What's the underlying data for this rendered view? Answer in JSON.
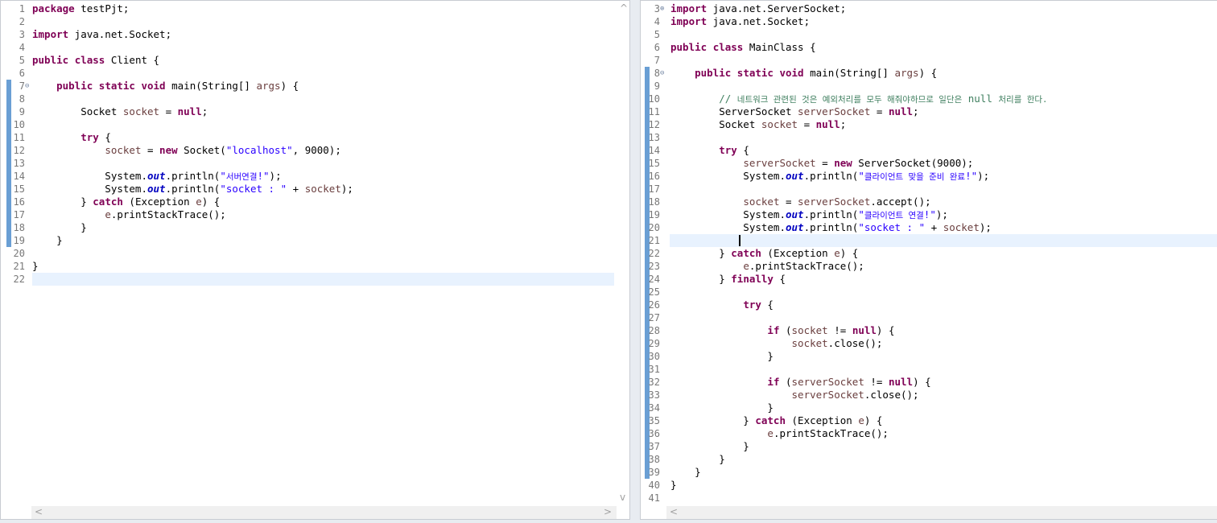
{
  "left_editor": {
    "lines": [
      {
        "n": "1",
        "html": "<span class=\"kw\">package</span> testPjt;"
      },
      {
        "n": "2",
        "html": ""
      },
      {
        "n": "3",
        "html": "<span class=\"kw\">import</span> java.net.Socket;"
      },
      {
        "n": "4",
        "html": ""
      },
      {
        "n": "5",
        "html": "<span class=\"kw\">public</span> <span class=\"kw\">class</span> Client {"
      },
      {
        "n": "6",
        "html": ""
      },
      {
        "n": "7",
        "fold": "⊖",
        "html": "    <span class=\"kw\">public</span> <span class=\"kw\">static</span> <span class=\"kw\">void</span> main(String[] <span class=\"var\">args</span>) {"
      },
      {
        "n": "8",
        "html": ""
      },
      {
        "n": "9",
        "html": "        Socket <span class=\"var\">socket</span> = <span class=\"kw\">null</span>;"
      },
      {
        "n": "10",
        "html": ""
      },
      {
        "n": "11",
        "html": "        <span class=\"kw\">try</span> {"
      },
      {
        "n": "12",
        "html": "            <span class=\"var\">socket</span> = <span class=\"kw\">new</span> Socket(<span class=\"str\">\"localhost\"</span>, 9000);"
      },
      {
        "n": "13",
        "html": ""
      },
      {
        "n": "14",
        "html": "            System.<span class=\"fld\">out</span>.println(<span class=\"str\">\"<span class=\"kr\">서버연결</span>!\"</span>);"
      },
      {
        "n": "15",
        "html": "            System.<span class=\"fld\">out</span>.println(<span class=\"str\">\"socket : \"</span> + <span class=\"var\">socket</span>);"
      },
      {
        "n": "16",
        "html": "        } <span class=\"kw\">catch</span> (Exception <span class=\"var\">e</span>) {"
      },
      {
        "n": "17",
        "html": "            <span class=\"var\">e</span>.printStackTrace();"
      },
      {
        "n": "18",
        "html": "        }"
      },
      {
        "n": "19",
        "html": "    }"
      },
      {
        "n": "20",
        "html": ""
      },
      {
        "n": "21",
        "html": "}"
      },
      {
        "n": "22",
        "html": "",
        "current": true
      }
    ]
  },
  "right_editor": {
    "lines": [
      {
        "n": "3",
        "fold": "⊕",
        "html": "<span class=\"kw\">import</span> java.net.ServerSocket;"
      },
      {
        "n": "4",
        "html": "<span class=\"kw\">import</span> java.net.Socket;"
      },
      {
        "n": "5",
        "html": ""
      },
      {
        "n": "6",
        "html": "<span class=\"kw\">public</span> <span class=\"kw\">class</span> MainClass {"
      },
      {
        "n": "7",
        "html": ""
      },
      {
        "n": "8",
        "fold": "⊖",
        "html": "    <span class=\"kw\">public</span> <span class=\"kw\">static</span> <span class=\"kw\">void</span> main(String[] <span class=\"var\">args</span>) {"
      },
      {
        "n": "9",
        "html": ""
      },
      {
        "n": "10",
        "html": "        <span class=\"cm\">// <span class=\"kr\">네트워크 관련된 것은 예외처리를 모두 해줘야하므로 일단은</span> null <span class=\"kr\">처리를 한다.</span></span>"
      },
      {
        "n": "11",
        "html": "        ServerSocket <span class=\"var\">serverSocket</span> = <span class=\"kw\">null</span>;"
      },
      {
        "n": "12",
        "html": "        Socket <span class=\"var\">socket</span> = <span class=\"kw\">null</span>;"
      },
      {
        "n": "13",
        "html": ""
      },
      {
        "n": "14",
        "html": "        <span class=\"kw\">try</span> {"
      },
      {
        "n": "15",
        "html": "            <span class=\"var\">serverSocket</span> = <span class=\"kw\">new</span> ServerSocket(9000);"
      },
      {
        "n": "16",
        "html": "            System.<span class=\"fld\">out</span>.println(<span class=\"str\">\"<span class=\"kr\">클라이언트 맞을 준비 완료</span>!\"</span>);"
      },
      {
        "n": "17",
        "html": ""
      },
      {
        "n": "18",
        "html": "            <span class=\"var\">socket</span> = <span class=\"var\">serverSocket</span>.accept();"
      },
      {
        "n": "19",
        "html": "            System.<span class=\"fld\">out</span>.println(<span class=\"str\">\"<span class=\"kr\">클라이언트 연결</span>!\"</span>);"
      },
      {
        "n": "20",
        "html": "            System.<span class=\"fld\">out</span>.println(<span class=\"str\">\"socket : \"</span> + <span class=\"var\">socket</span>);"
      },
      {
        "n": "21",
        "html": "",
        "current": true,
        "caret": true
      },
      {
        "n": "22",
        "html": "        } <span class=\"kw\">catch</span> (Exception <span class=\"var\">e</span>) {"
      },
      {
        "n": "23",
        "html": "            <span class=\"var\">e</span>.printStackTrace();"
      },
      {
        "n": "24",
        "html": "        } <span class=\"kw\">finally</span> {"
      },
      {
        "n": "25",
        "html": ""
      },
      {
        "n": "26",
        "html": "            <span class=\"kw\">try</span> {"
      },
      {
        "n": "27",
        "html": ""
      },
      {
        "n": "28",
        "html": "                <span class=\"kw\">if</span> (<span class=\"var\">socket</span> != <span class=\"kw\">null</span>) {"
      },
      {
        "n": "29",
        "html": "                    <span class=\"var\">socket</span>.close();"
      },
      {
        "n": "30",
        "html": "                }"
      },
      {
        "n": "31",
        "html": ""
      },
      {
        "n": "32",
        "html": "                <span class=\"kw\">if</span> (<span class=\"var\">serverSocket</span> != <span class=\"kw\">null</span>) {"
      },
      {
        "n": "33",
        "html": "                    <span class=\"var\">serverSocket</span>.close();"
      },
      {
        "n": "34",
        "html": "                }"
      },
      {
        "n": "35",
        "html": "            } <span class=\"kw\">catch</span> (Exception <span class=\"var\">e</span>) {"
      },
      {
        "n": "36",
        "html": "                <span class=\"var\">e</span>.printStackTrace();"
      },
      {
        "n": "37",
        "html": "            }"
      },
      {
        "n": "38",
        "html": "        }"
      },
      {
        "n": "39",
        "html": "    }"
      },
      {
        "n": "40",
        "html": "}"
      },
      {
        "n": "41",
        "html": ""
      }
    ]
  },
  "colors": {
    "keyword": "#7f0055",
    "string": "#2a00ff",
    "comment": "#3f7f5f",
    "local_variable": "#6a3e3e",
    "static_field": "#0000c0",
    "change_bar": "#6a9fd4",
    "current_line": "#e8f2fe"
  },
  "icons": {
    "scroll_up": "^",
    "scroll_down": "v",
    "scroll_left": "<",
    "scroll_right": ">"
  }
}
